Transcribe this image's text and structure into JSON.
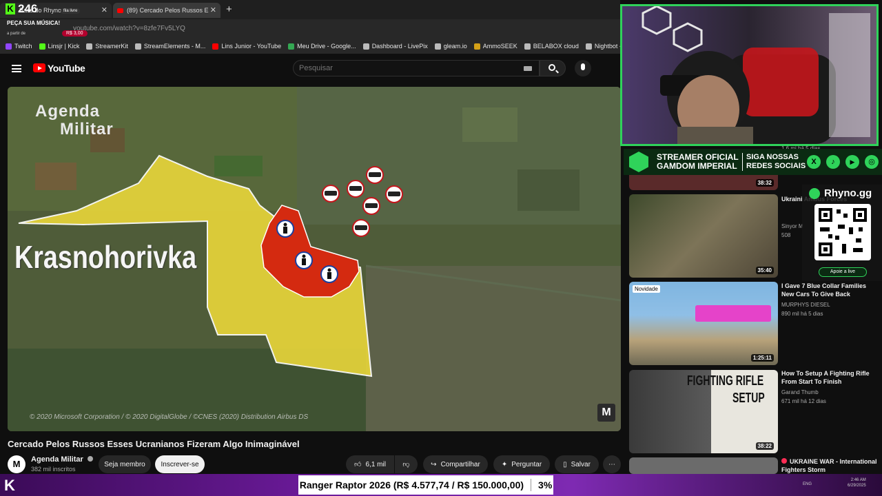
{
  "browser": {
    "tabs": [
      {
        "label": "Baile do Rhyno"
      },
      {
        "label": "(89) Cercado Pelos Russos E"
      }
    ],
    "url": "youtube.com/watch?v=8zfe7Fv5LYQ",
    "bookmarks": [
      {
        "label": "Twitch",
        "color": "#9146ff"
      },
      {
        "label": "Linsjr | Kick",
        "color": "#53fc18"
      },
      {
        "label": "StreamerKit",
        "color": "#bbbbbb"
      },
      {
        "label": "StreamElements - M...",
        "color": "#bbbbbb"
      },
      {
        "label": "Lins Junior - YouTube",
        "color": "#ff0000"
      },
      {
        "label": "Meu Drive - Google...",
        "color": "#34a853"
      },
      {
        "label": "Dashboard - LivePix",
        "color": "#bbbbbb"
      },
      {
        "label": "gleam.io",
        "color": "#bbbbbb"
      },
      {
        "label": "AmmoSEEK",
        "color": "#d4a017"
      },
      {
        "label": "BELABOX cloud",
        "color": "#bbbbbb"
      },
      {
        "label": "Nightbot - Comm",
        "color": "#bbbbbb"
      }
    ]
  },
  "stream_overlay": {
    "viewer_count": "246",
    "fila_label": "fila livre",
    "music_title": "PEÇA SUA MÚSICA!",
    "music_sub": "a partir de",
    "music_price": "R$ 3,00"
  },
  "youtube": {
    "logo_text": "YouTube",
    "search_placeholder": "Pesquisar",
    "video": {
      "overlay_title_line1": "Agenda",
      "overlay_title_line2": "Militar",
      "town_label": "Krasnohorivka",
      "copyright": "© 2020 Microsoft Corporation / © 2020 DigitalGlobe / ©CNES (2020) Distribution Airbus DS",
      "logo_letter": "M",
      "colors": {
        "ukraine_zone": "#e6d43a",
        "russian_zone": "#d42a10",
        "terrain": "#4d5a37"
      }
    },
    "title": "Cercado Pelos Russos Esses Ucranianos Fizeram Algo Inimaginável",
    "channel": {
      "avatar_letter": "M",
      "name": "Agenda Militar",
      "subscribers": "382 mil inscritos"
    },
    "actions": {
      "member": "Seja membro",
      "subscribe": "Inscrever-se",
      "likes": "6,1 mil",
      "share": "Compartilhar",
      "ask": "Perguntar",
      "save": "Salvar",
      "more": "⋯"
    },
    "recommendations": [
      {
        "title": "Ukraini Ambus Forces",
        "channel": "Sinyor M",
        "meta": "508",
        "duration": "35:40"
      },
      {
        "title": "I Gave 7 Blue Collar Families New Cars To Give Back",
        "channel": "MURPHYS DIESEL",
        "meta": "890 mil  há 5 dias",
        "duration": "1:25:11",
        "badge": "Novidade"
      },
      {
        "title": "How To Setup A Fighting Rifle From Start To Finish",
        "channel": "Garand Thumb",
        "meta": "671 mil  há 12 dias",
        "duration": "38:22",
        "thumb_text_1": "FIGHTING RIFLE",
        "thumb_text_2": "SETUP"
      },
      {
        "title": "UKRAINE WAR - International Fighters Storm",
        "channel": "",
        "meta": "",
        "duration": ""
      }
    ],
    "top_partial": {
      "meta": "1,6 mi  há 5 dias",
      "duration": "38:32"
    }
  },
  "streamer_banner": {
    "line1a": "STREAMER OFICIAL",
    "line1b": "GAMDOM IMPERIAL",
    "line2a": "SIGA NOSSAS",
    "line2b": "REDES SOCIAIS"
  },
  "rhyno_card": {
    "brand": "Rhyno.gg",
    "cta": "Apoie a live"
  },
  "ticker": {
    "text": "Ranger Raptor 2026 (R$ 4.577,74 / R$ 150.000,00)",
    "percent": "3%"
  },
  "taskbar": {
    "lang": "ENG",
    "time": "2:46 AM",
    "date": "6/29/2025"
  }
}
